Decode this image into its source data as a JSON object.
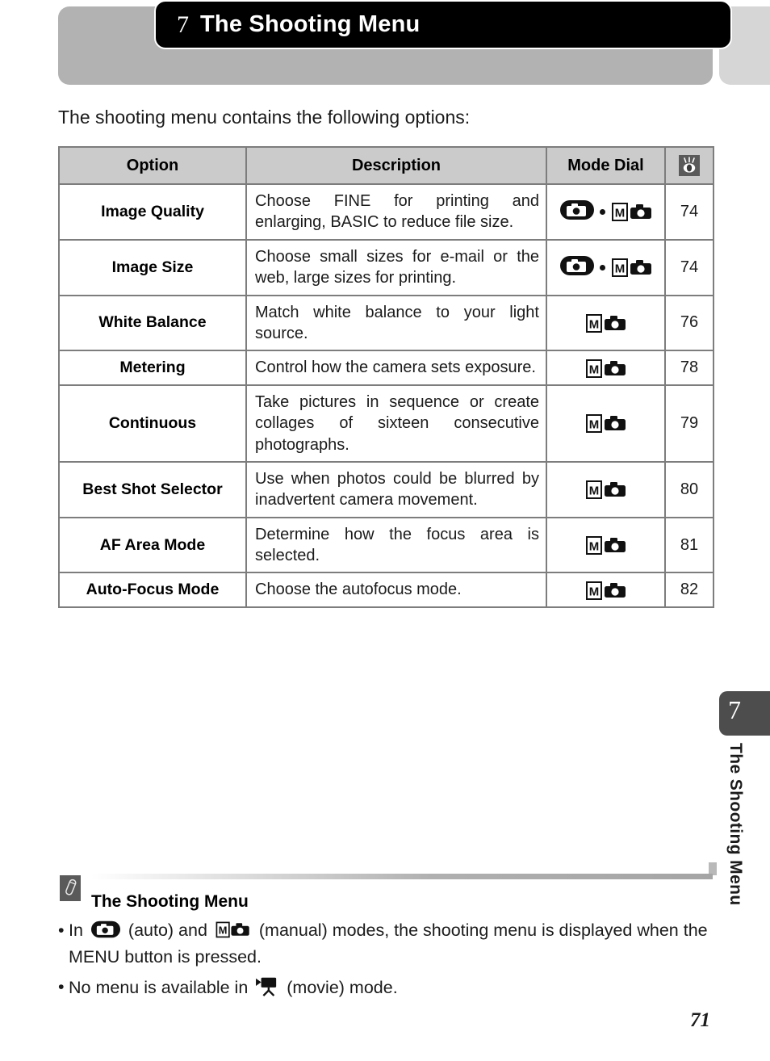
{
  "header": {
    "chapter_number": "7",
    "title": "The Shooting Menu"
  },
  "intro": "The shooting menu contains the following options:",
  "table": {
    "columns": [
      "Option",
      "Description",
      "Mode Dial",
      "page-ref-icon"
    ],
    "rows": [
      {
        "option": "Image Quality",
        "description": "Choose FINE for printing and enlarging, BASIC to reduce file size.",
        "mode": "auto-dot-manual",
        "page": "74"
      },
      {
        "option": "Image Size",
        "description": "Choose small sizes for e-mail or the web, large sizes for printing.",
        "mode": "auto-dot-manual",
        "page": "74"
      },
      {
        "option": "White Balance",
        "description": "Match white balance to your light source.",
        "mode": "manual",
        "page": "76"
      },
      {
        "option": "Metering",
        "description": "Control how the camera sets exposure.",
        "mode": "manual",
        "page": "78"
      },
      {
        "option": "Continuous",
        "description": "Take pictures in sequence or create collages of sixteen consecutive photographs.",
        "mode": "manual",
        "page": "79"
      },
      {
        "option": "Best Shot Selector",
        "description": "Use when photos could be blurred by inadvertent camera movement.",
        "mode": "manual",
        "page": "80"
      },
      {
        "option": "AF Area Mode",
        "description": "Determine how the focus area is selected.",
        "mode": "manual",
        "page": "81"
      },
      {
        "option": "Auto-Focus Mode",
        "description": "Choose the autofocus mode.",
        "mode": "manual",
        "page": "82"
      }
    ]
  },
  "note": {
    "icon": "pencil-icon",
    "title": "The Shooting Menu",
    "items": [
      {
        "prefix": "In",
        "icon1": "auto-mode-icon",
        "mid1": "(auto) and",
        "icon2": "manual-mode-icon",
        "suffix": "(manual) modes, the shooting menu is displayed when the MENU button is pressed."
      },
      {
        "prefix": "No menu is available in",
        "icon1": "movie-mode-icon",
        "suffix": "(movie) mode."
      }
    ]
  },
  "side_tab": {
    "number": "7",
    "label": "The Shooting Menu"
  },
  "page_number": "71",
  "colors": {
    "banner_black": "#000000",
    "banner_grey": "#b2b2b2",
    "banner_grey_right": "#d6d6d6",
    "table_header_bg": "#cbcbcb",
    "table_border": "#7d7d7d",
    "side_tab_bg": "#4d4d4d",
    "icon_grey": "#5a5a5a"
  }
}
